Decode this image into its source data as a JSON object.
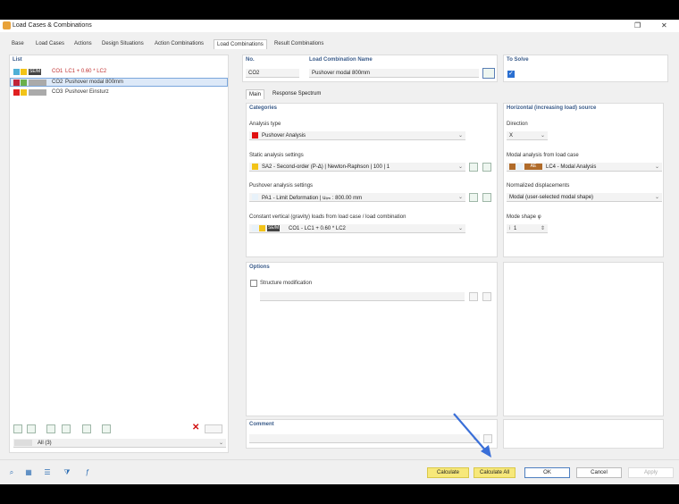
{
  "window": {
    "title": "Load Cases & Combinations",
    "restore_glyph": "❐",
    "close_glyph": "✕"
  },
  "tabs": [
    "Base",
    "Load Cases",
    "Actions",
    "Design Situations",
    "Action Combinations",
    "Load Combinations",
    "Result Combinations"
  ],
  "active_tab": "Load Combinations",
  "list": {
    "header": "List",
    "items": [
      {
        "tag": "SE/M",
        "id": "CO1",
        "name": "LC1 + 0.60 * LC2",
        "colors": [
          "#4fb0d6",
          "#f2c318"
        ]
      },
      {
        "tag": "",
        "id": "CO2",
        "name": "Pushover modal 800mm",
        "colors": [
          "#c0243a",
          "#6ab04c"
        ]
      },
      {
        "tag": "",
        "id": "CO3",
        "name": "Pushover Einsturz",
        "colors": [
          "#e02020",
          "#f2c318"
        ]
      }
    ],
    "filter": "All (3)",
    "delete_glyph": "✕"
  },
  "top": {
    "no_label": "No.",
    "no_value": "CO2",
    "name_label": "Load Combination Name",
    "name_value": "Pushover modal 800mm",
    "solve_label": "To Solve"
  },
  "subtabs": [
    "Main",
    "Response Spectrum"
  ],
  "categories": {
    "header": "Categories",
    "analysis_type_label": "Analysis type",
    "analysis_type_value": "Pushover Analysis",
    "static_label": "Static analysis settings",
    "static_value": "SA2 - Second-order (P-Δ) | Newton-Raphson | 100 | 1",
    "pushover_label": "Pushover analysis settings",
    "pushover_value": "PA1 - Limit Deformation | uₗᵢₘ : 800.00 mm",
    "constant_label": "Constant vertical (gravity) loads from load case / load combination",
    "constant_tag": "SE/M",
    "constant_value": "CO1 - LC1 + 0.60 * LC2"
  },
  "horizontal": {
    "header": "Horizontal (increasing load) source",
    "direction_label": "Direction",
    "direction_value": "X",
    "modal_label": "Modal analysis from load case",
    "modal_tag": "AE",
    "modal_value": "LC4 - Modal Analysis",
    "normalized_label": "Normalized displacements",
    "normalized_value": "Modal (user-selected modal shape)",
    "mode_label": "Mode shape φ",
    "mode_prefix": "i",
    "mode_value": "1"
  },
  "options": {
    "header": "Options",
    "structure_mod_label": "Structure modification"
  },
  "comment": {
    "header": "Comment"
  },
  "buttons": {
    "calculate": "Calculate",
    "calculate_all": "Calculate All",
    "ok": "OK",
    "cancel": "Cancel",
    "apply": "Apply"
  },
  "colors": {
    "accent": "#3b5c8a",
    "calc_button": "#f7e87a",
    "arrow": "#3a6fd8"
  }
}
